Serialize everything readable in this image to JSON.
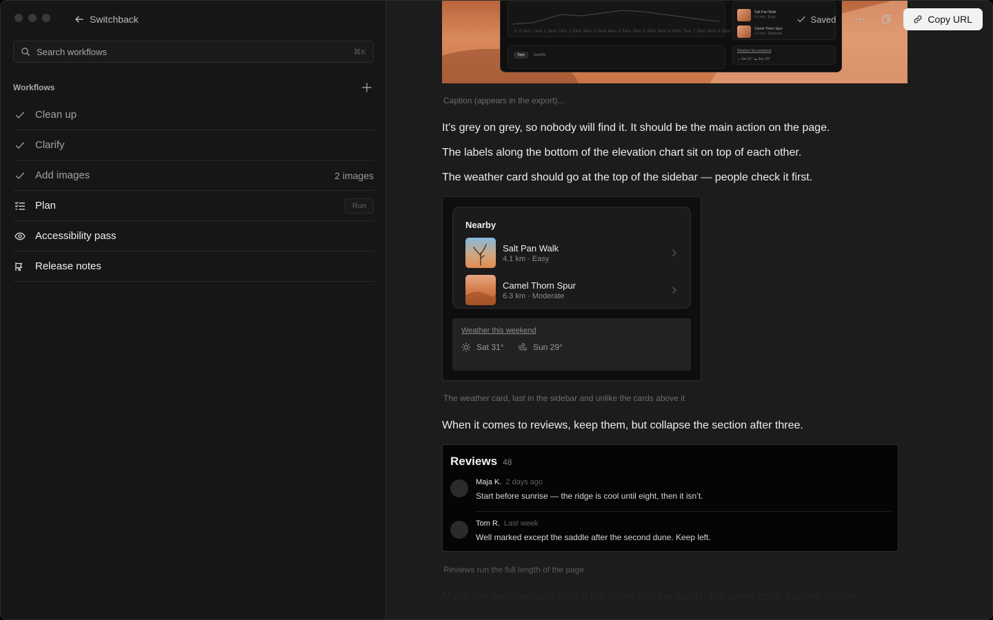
{
  "sidebar": {
    "back_label": "Switchback",
    "search_placeholder": "Search workflows",
    "search_shortcut": "⌘K",
    "section_label": "Workflows",
    "items": [
      {
        "label": "Clean up",
        "icon": "check-icon",
        "state": "done",
        "meta": ""
      },
      {
        "label": "Clarify",
        "icon": "check-icon",
        "state": "done",
        "meta": ""
      },
      {
        "label": "Add images",
        "icon": "check-icon",
        "state": "done",
        "meta": "2 images"
      },
      {
        "label": "Plan",
        "icon": "list-check-icon",
        "state": "active",
        "action": "Run"
      },
      {
        "label": "Accessibility pass",
        "icon": "eye-icon",
        "state": "active",
        "meta": ""
      },
      {
        "label": "Release notes",
        "icon": "megaphone-icon",
        "state": "active",
        "meta": ""
      }
    ]
  },
  "toolbar": {
    "saved_label": "Saved",
    "copy_label": "Copy URL"
  },
  "hero_mock": {
    "toggle_on": "Topo",
    "toggle_off": "Satellite",
    "trails": [
      {
        "name": "Salt Pan Walk",
        "sub": "4.1 km · Easy"
      },
      {
        "name": "Camel Thorn Spur",
        "sub": "6.3 km · Moderate"
      }
    ],
    "weather_link": "Weather this weekend",
    "weather_line": "☼ Sat 31°   ☁ Sun 29°"
  },
  "doc": {
    "caption_placeholder": "Caption (appears in the export)...",
    "paragraphs": [
      "It’s grey on grey, so nobody will find it. It should be the main action on the page.",
      "The labels along the bottom of the elevation chart sit on top of each other.",
      "The weather card should go at the top of the sidebar — people check it first."
    ],
    "caption_weather": "The weather card, last in the sidebar and unlike the cards above it",
    "paragraph_reviews": "When it comes to reviews, keep them, but collapse the section after three.",
    "caption_reviews": "Reviews run the full length of the page",
    "paragraph_faded": "Make the weather card match the other sidebar cards: the same card, hairline border"
  },
  "nearby": {
    "title": "Nearby",
    "trails": [
      {
        "name": "Salt Pan Walk",
        "sub": "4.1 km · Easy"
      },
      {
        "name": "Camel Thorn Spur",
        "sub": "6.3 km · Moderate"
      }
    ]
  },
  "weather": {
    "link": "Weather this weekend",
    "days": [
      {
        "label": "Sat 31°",
        "icon": "sun-icon"
      },
      {
        "label": "Sun 29°",
        "icon": "wind-cloud-icon"
      }
    ]
  },
  "reviews": {
    "title": "Reviews",
    "count": "48",
    "items": [
      {
        "name": "Maja K.",
        "when": "2 days ago",
        "text": "Start before sunrise — the ridge is cool until eight, then it isn’t."
      },
      {
        "name": "Tom R.",
        "when": "Last week",
        "text": "Well marked except the saddle after the second dune. Keep left."
      }
    ]
  },
  "colors": {
    "accent_button": "#f2f2f2",
    "sidebar_bg": "#161616",
    "main_bg": "#1c1c1c"
  }
}
